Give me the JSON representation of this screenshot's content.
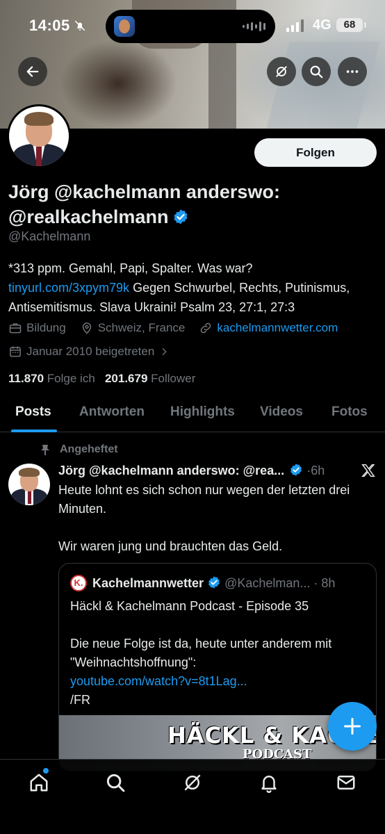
{
  "status_bar": {
    "time": "14:05",
    "network": "4G",
    "battery": "68"
  },
  "profile": {
    "follow_label": "Folgen",
    "display_name": "Jörg @kachelmann anderswo: @realkachelmann",
    "handle": "@Kachelmann",
    "bio": {
      "part1": "*313 ppm. Gemahl, Papi, Spalter. Was war? ",
      "link": "tinyurl.com/3xpym79k",
      "part2": " Gegen Schwurbel, Rechts, Putinismus, Antisemitismus. Slava Ukraini! Psalm 23, 27:1, 27:3"
    },
    "category": "Bildung",
    "location": "Schweiz, France",
    "website": "kachelmannwetter.com",
    "joined": "Januar 2010 beigetreten",
    "following_count": "11.870",
    "following_label": "Folge ich",
    "followers_count": "201.679",
    "followers_label": "Follower"
  },
  "tabs": [
    {
      "label": "Posts",
      "active": true
    },
    {
      "label": "Antworten",
      "active": false
    },
    {
      "label": "Highlights",
      "active": false
    },
    {
      "label": "Videos",
      "active": false
    },
    {
      "label": "Fotos",
      "active": false
    }
  ],
  "tweet": {
    "pinned_label": "Angeheftet",
    "author": "Jörg @kachelmann anderswo: @rea...",
    "time": "6h",
    "text": "Heute lohnt es sich schon nur wegen der letzten drei Minuten.\n\nWir waren jung und brauchten das Geld.",
    "quote": {
      "author": "Kachelmannwetter",
      "handle": "@Kachelman...",
      "time": "8h",
      "logo_text": "K.",
      "text_line1": "Häckl & Kachelmann Podcast -  Episode 35",
      "text_line2": "Die neue Folge ist da, heute unter anderem mit \"Weihnachtshoffnung\":",
      "link": "youtube.com/watch?v=8t1Lag...",
      "signature": "/FR",
      "media_title": "HÄCKL & KACHELM",
      "media_subtitle": "PODCAST"
    }
  },
  "colors": {
    "accent": "#1d9bf0",
    "background": "#000000",
    "text_primary": "#e7e9ea",
    "text_secondary": "#71767b"
  },
  "icons": {
    "back": "arrow-left-icon",
    "grok": "grok-icon",
    "search": "search-icon",
    "more": "more-icon",
    "home": "home-icon",
    "explore": "search-icon",
    "grok_nav": "grok-icon",
    "notifications": "bell-icon",
    "messages": "mail-icon",
    "compose": "plus-icon"
  }
}
